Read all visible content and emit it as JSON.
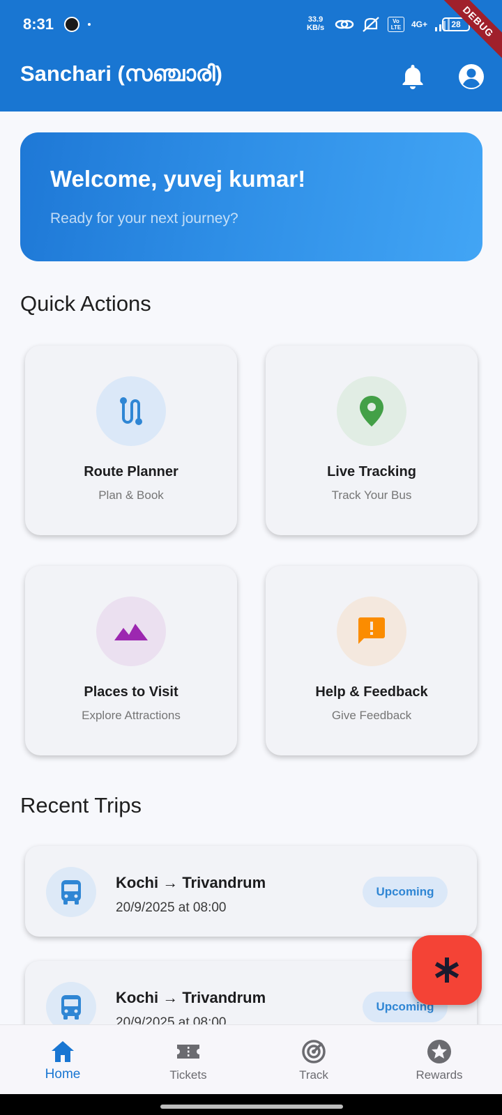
{
  "status_bar": {
    "time": "8:31",
    "speed_value": "33.9",
    "speed_unit": "KB/s",
    "network": "4G+",
    "volte": "Vo LTE",
    "battery": "28",
    "debug_banner": "DEBUG"
  },
  "app_bar": {
    "title": "Sanchari (സഞ്ചാരി)",
    "icons": [
      "bell-icon",
      "account-circle-icon"
    ]
  },
  "welcome": {
    "title": "Welcome, yuvej kumar!",
    "subtitle": "Ready for your next journey?"
  },
  "quick_actions": {
    "heading": "Quick Actions",
    "items": [
      {
        "title": "Route Planner",
        "subtitle": "Plan & Book",
        "icon": "route-icon",
        "color": "#2f86d4",
        "bg": "#dbe8f8"
      },
      {
        "title": "Live Tracking",
        "subtitle": "Track Your Bus",
        "icon": "location-pin-icon",
        "color": "#43a047",
        "bg": "#e1ede4"
      },
      {
        "title": "Places to Visit",
        "subtitle": "Explore Attractions",
        "icon": "landscape-icon",
        "color": "#9c27b0",
        "bg": "#ebe0f0"
      },
      {
        "title": "Help & Feedback",
        "subtitle": "Give Feedback",
        "icon": "feedback-icon",
        "color": "#fb8c00",
        "bg": "#f4e8de"
      }
    ]
  },
  "recent_trips": {
    "heading": "Recent Trips",
    "items": [
      {
        "route": "Kochi → Trivandrum",
        "datetime": "20/9/2025 at 08:00",
        "status": "Upcoming"
      },
      {
        "route": "Kochi → Trivandrum",
        "datetime": "20/9/2025 at 08:00",
        "status": "Upcoming"
      }
    ]
  },
  "fab": {
    "icon": "asterisk-icon",
    "color": "#f44336"
  },
  "bottom_nav": {
    "items": [
      {
        "label": "Home",
        "icon": "home-icon",
        "active": true
      },
      {
        "label": "Tickets",
        "icon": "ticket-icon",
        "active": false
      },
      {
        "label": "Track",
        "icon": "radar-icon",
        "active": false
      },
      {
        "label": "Rewards",
        "icon": "star-badge-icon",
        "active": false
      }
    ]
  },
  "colors": {
    "primary": "#1976d2",
    "background": "#f7f8fc",
    "badge_text": "#2f86d4"
  }
}
